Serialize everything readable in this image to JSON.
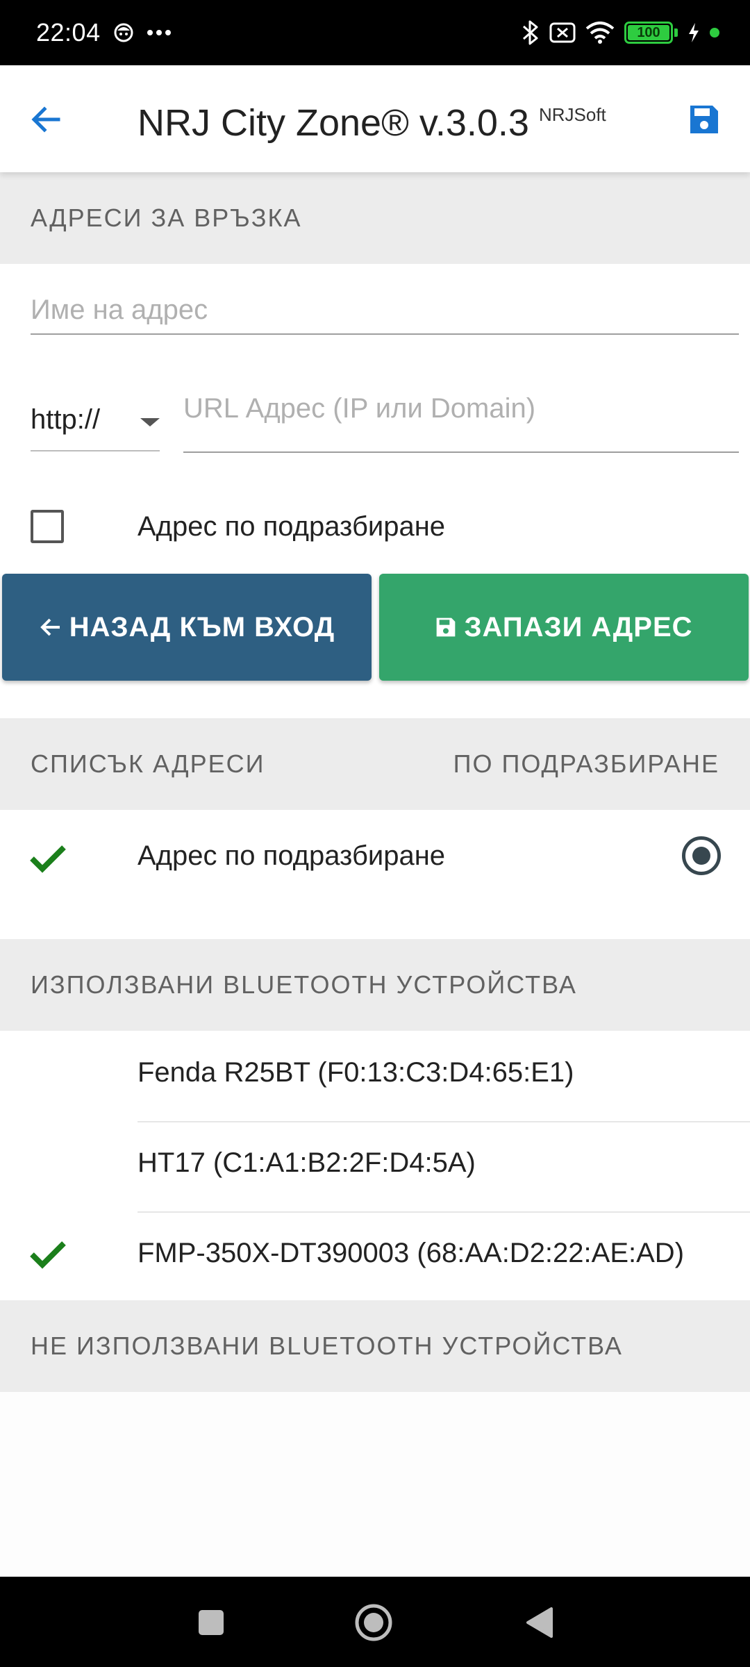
{
  "status_bar": {
    "time": "22:04",
    "battery": "100"
  },
  "app_bar": {
    "title": "NRJ City Zone® v.3.0.3",
    "subtitle": "NRJSoft"
  },
  "sections": {
    "contact_addresses": "АДРЕСИ ЗА ВРЪЗКА",
    "address_list": "СПИСЪК АДРЕСИ",
    "default_col": "ПО ПОДРАЗБИРАНЕ",
    "used_bt": "ИЗПОЛЗВАНИ BLUETOOTH УСТРОЙСТВА",
    "unused_bt": "НЕ ИЗПОЛЗВАНИ BLUETOOTH УСТРОЙСТВА"
  },
  "form": {
    "name_placeholder": "Име на адрес",
    "protocol_value": "http://",
    "url_placeholder": "URL Адрес (IP или Domain)",
    "default_checkbox_label": "Адрес по подразбиране",
    "default_checked": false
  },
  "buttons": {
    "back_to_login": "НАЗАД КЪМ ВХОД",
    "save_address": "ЗАПАЗИ АДРЕС"
  },
  "address_list": [
    {
      "label": "Адрес по подразбиране",
      "checked": true,
      "default": true
    }
  ],
  "used_bluetooth_devices": [
    {
      "label": "Fenda R25BT (F0:13:C3:D4:65:E1)",
      "checked": false
    },
    {
      "label": "HT17 (C1:A1:B2:2F:D4:5A)",
      "checked": false
    },
    {
      "label": "FMP-350X-DT390003 (68:AA:D2:22:AE:AD)",
      "checked": true
    }
  ],
  "colors": {
    "primary_blue": "#1976d2",
    "back_button": "#2e5f82",
    "save_button": "#34a56b",
    "check_green": "#1b7f1b",
    "section_bg": "#ececec"
  },
  "icons": {
    "back": "arrow-left-icon",
    "save": "floppy-disk-icon",
    "check": "checkmark-icon",
    "nav_recents": "square-icon",
    "nav_home": "circle-icon",
    "nav_back": "triangle-back-icon"
  }
}
